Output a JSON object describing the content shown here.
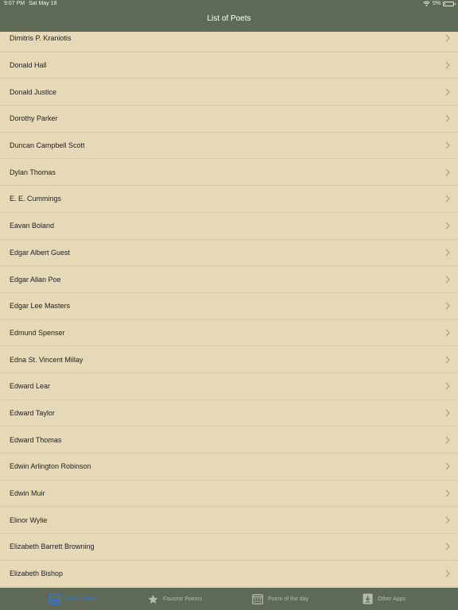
{
  "status_bar": {
    "time": "9:07 PM",
    "date": "Sat May 18",
    "battery": "5%"
  },
  "header": {
    "title": "List of Poets"
  },
  "poets": [
    "Dimitris P. Kraniotis",
    "Donald Hall",
    "Donald Justice",
    "Dorothy Parker",
    "Duncan Campbell Scott",
    "Dylan Thomas",
    "E. E. Cummings",
    "Eavan Boland",
    "Edgar Albert Guest",
    "Edgar Allan Poe",
    "Edgar Lee Masters",
    "Edmund Spenser",
    "Edna St. Vincent Millay",
    "Edward Lear",
    "Edward Taylor",
    "Edward Thomas",
    "Edwin Arlington Robinson",
    "Edwin Muir",
    "Elinor Wylie",
    "Elizabeth Barrett Browning",
    "Elizabeth Bishop"
  ],
  "tabs": [
    {
      "label": "List of Poets",
      "icon": "list-icon",
      "active": true
    },
    {
      "label": "Favorite Poems",
      "icon": "star-icon",
      "active": false
    },
    {
      "label": "Poem of the day",
      "icon": "calendar-icon",
      "active": false
    },
    {
      "label": "Other Apps",
      "icon": "download-icon",
      "active": false
    }
  ],
  "colors": {
    "bar_background": "#5e6a56",
    "list_background": "#e6d9b8",
    "active_tab": "#2b7cf0",
    "inactive_tab": "#b7bbb0"
  }
}
